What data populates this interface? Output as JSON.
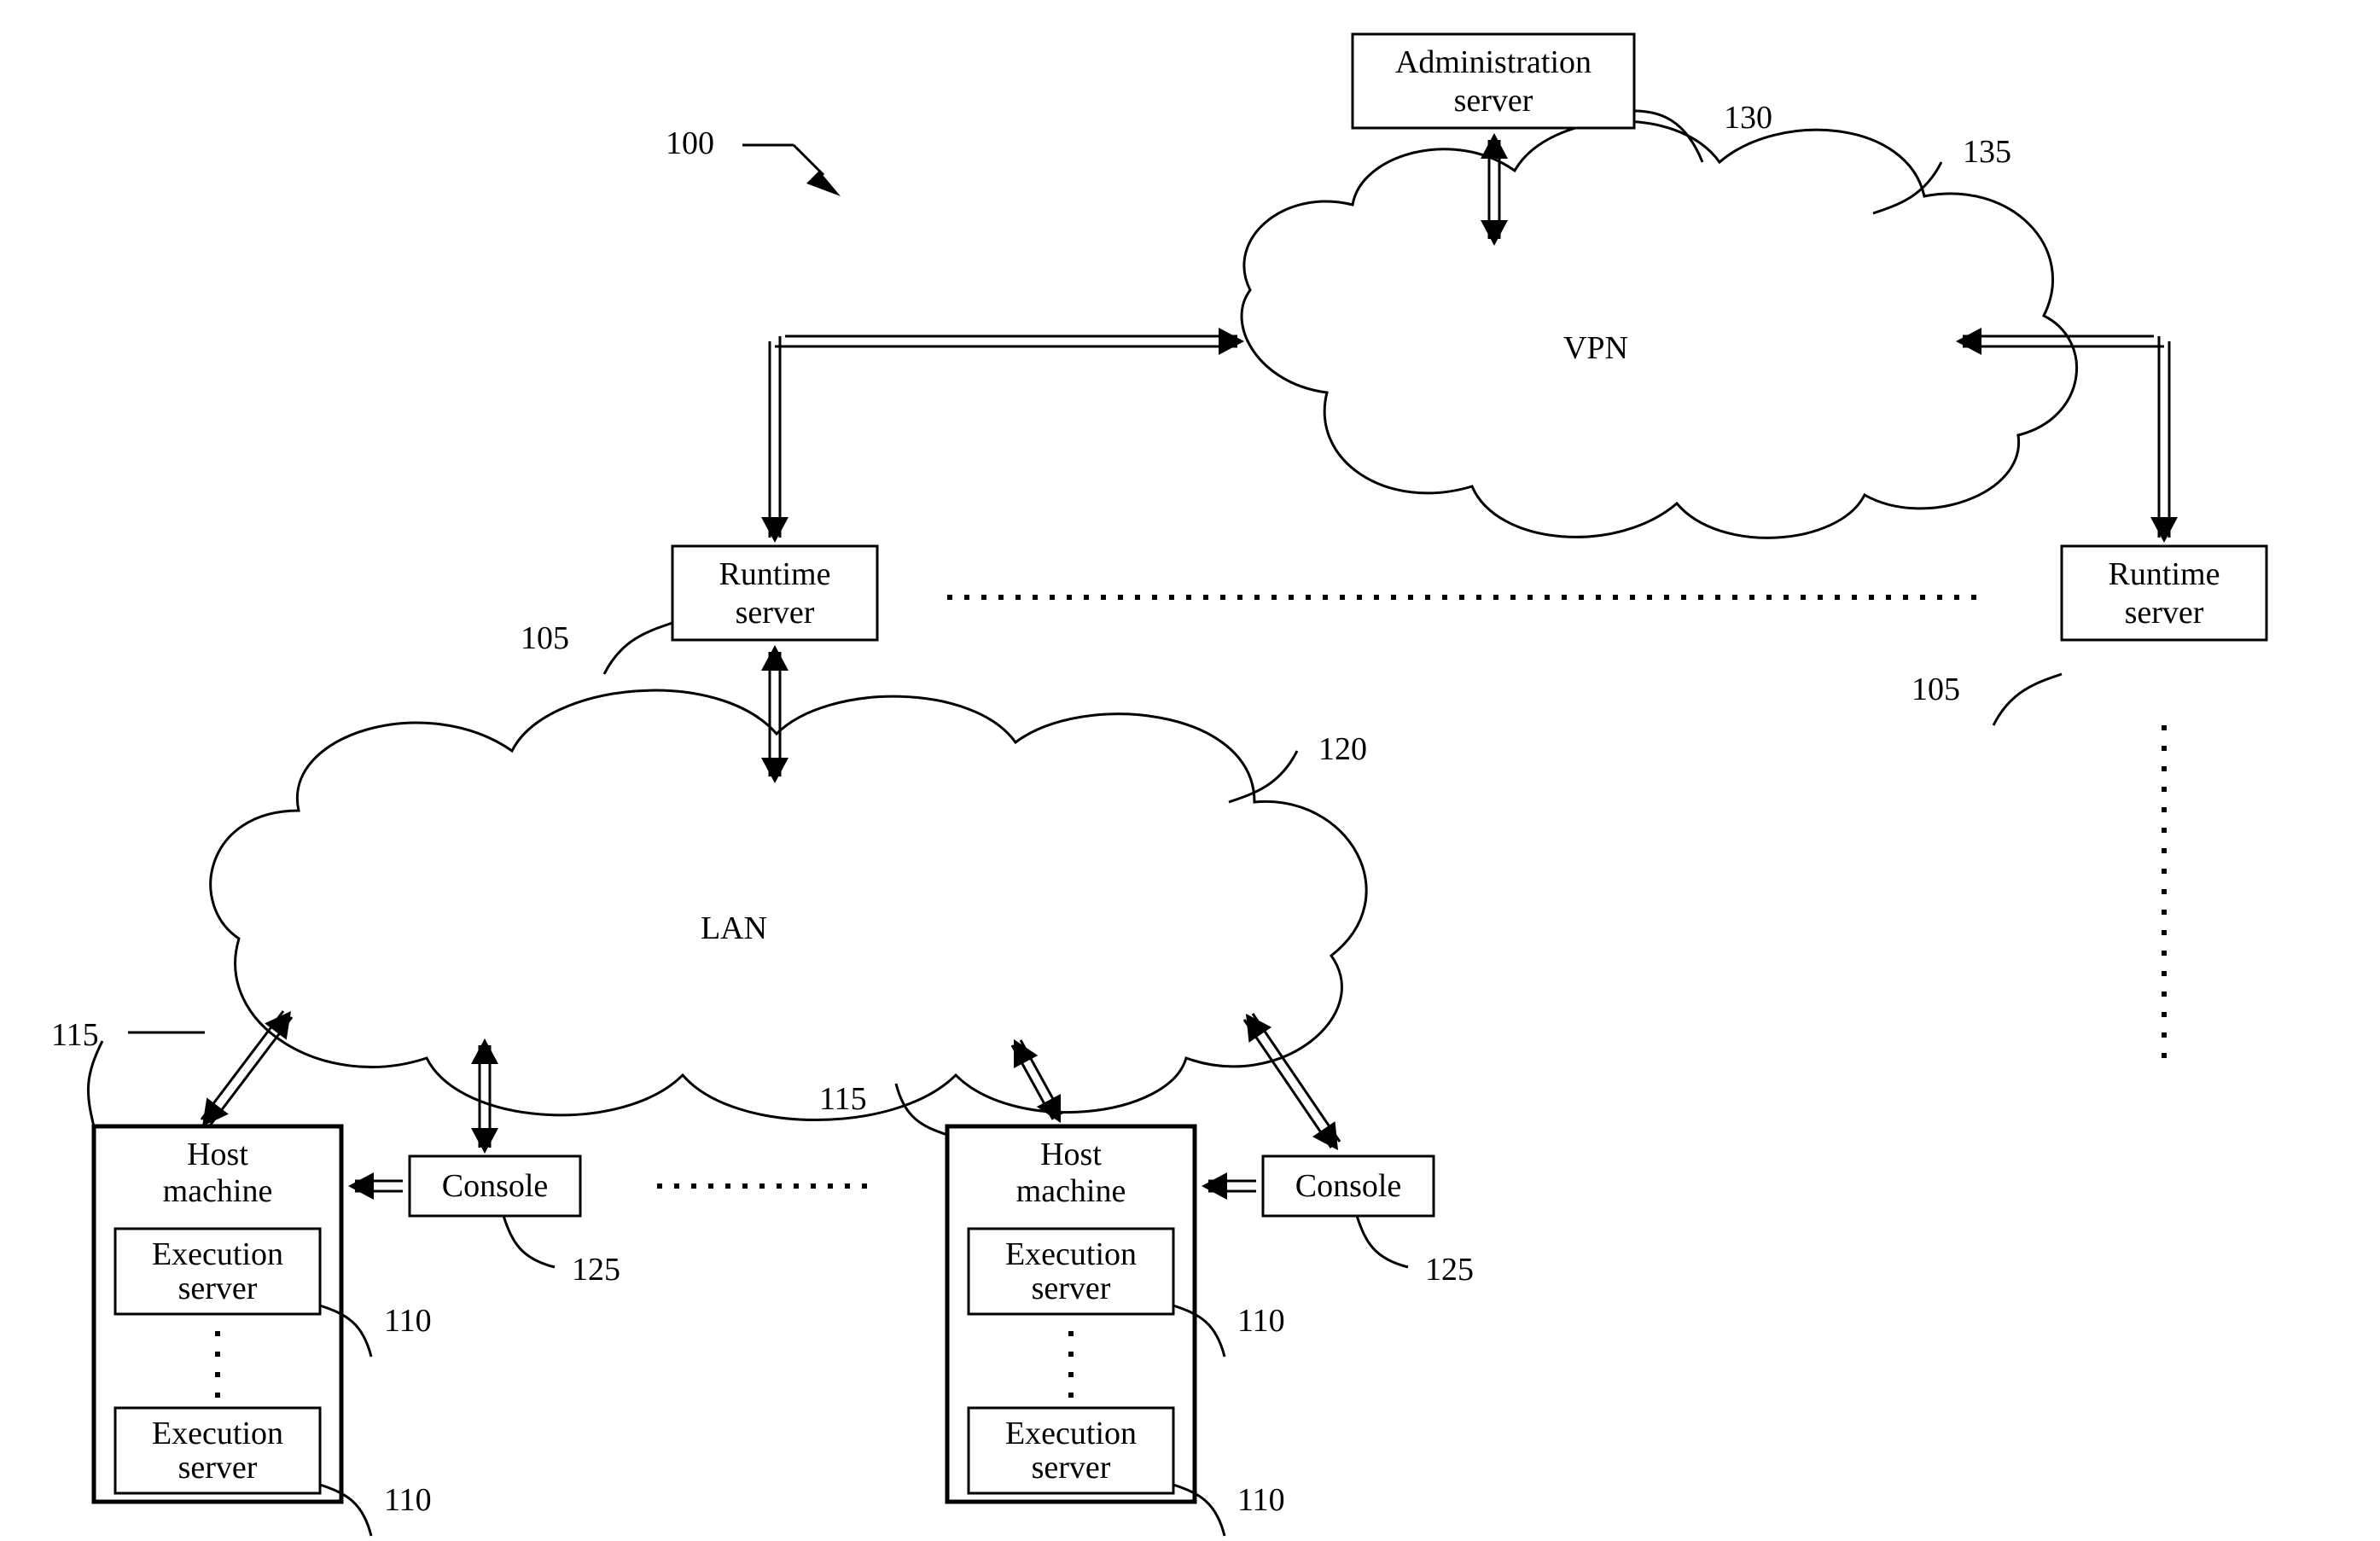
{
  "diagram": {
    "admin_server": "Administration server",
    "vpn": "VPN",
    "runtime_server": "Runtime server",
    "lan": "LAN",
    "host_machine": "Host machine",
    "console": "Console",
    "execution_server": "Execution server",
    "ref": {
      "system": "100",
      "runtime": "105",
      "exec": "110",
      "host": "115",
      "lan": "120",
      "console": "125",
      "admin": "130",
      "vpn": "135"
    }
  }
}
